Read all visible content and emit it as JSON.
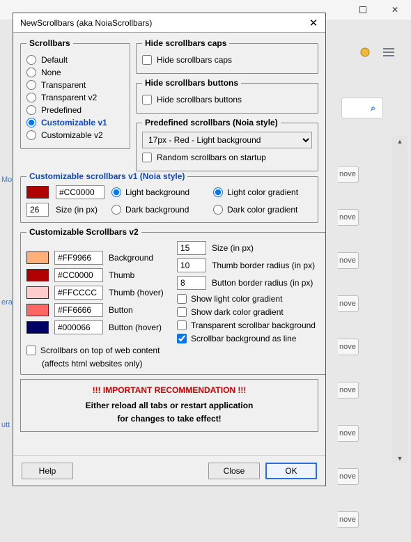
{
  "window": {
    "title": "NewScrollbars (aka NoiaScrollbars)"
  },
  "scrollbars_group": {
    "legend": "Scrollbars",
    "options": {
      "default": "Default",
      "none": "None",
      "transparent": "Transparent",
      "transparent_v2": "Transparent v2",
      "predefined": "Predefined",
      "custom_v1": "Customizable v1",
      "custom_v2": "Customizable v2"
    }
  },
  "hide_caps": {
    "legend": "Hide scrollbars caps",
    "label": "Hide scrollbars caps"
  },
  "hide_buttons": {
    "legend": "Hide scrollbars buttons",
    "label": "Hide scrollbars buttons"
  },
  "predefined": {
    "legend": "Predefined scrollbars (Noia style)",
    "selected": "17px - Red - Light background",
    "random_label": "Random scrollbars on startup"
  },
  "v1": {
    "legend": "Customizable scrollbars v1 (Noia style)",
    "color_hex": "#CC0000",
    "swatch_color": "#b10000",
    "size_value": "26",
    "size_label": "Size (in px)",
    "bg_light": "Light background",
    "bg_dark": "Dark background",
    "grad_light": "Light color gradient",
    "grad_dark": "Dark color gradient"
  },
  "v2": {
    "legend": "Customizable Scrollbars v2",
    "rows": {
      "background": {
        "swatch": "#ffb07a",
        "hex": "#FF9966",
        "label": "Background"
      },
      "thumb": {
        "swatch": "#b10000",
        "hex": "#CC0000",
        "label": "Thumb"
      },
      "thumb_hover": {
        "swatch": "#ffcccc",
        "hex": "#FFCCCC",
        "label": "Thumb (hover)"
      },
      "button": {
        "swatch": "#ff6666",
        "hex": "#FF6666",
        "label": "Button"
      },
      "button_hover": {
        "swatch": "#000066",
        "hex": "#000066",
        "label": "Button (hover)"
      }
    },
    "size_value": "15",
    "size_label": "Size (in px)",
    "thumb_radius_value": "10",
    "thumb_radius_label": "Thumb border radius (in px)",
    "button_radius_value": "8",
    "button_radius_label": "Button border radius (in px)",
    "chk_light": "Show light color gradient",
    "chk_dark": "Show dark color gradient",
    "chk_transparent": "Transparent scrollbar background",
    "chk_line": "Scrollbar background as line",
    "chk_ontop": "Scrollbars on top of web content",
    "chk_ontop_sub": "(affects html websites only)"
  },
  "warn": {
    "header": "!!! IMPORTANT RECOMMENDATION !!!",
    "line1": "Either reload all tabs or restart application",
    "line2": "for changes to take effect!"
  },
  "footer": {
    "help": "Help",
    "close": "Close",
    "ok": "OK"
  },
  "bg": {
    "ghost_btn": "nove",
    "left1": "Mo",
    "left2": "era",
    "left3": "utt"
  }
}
